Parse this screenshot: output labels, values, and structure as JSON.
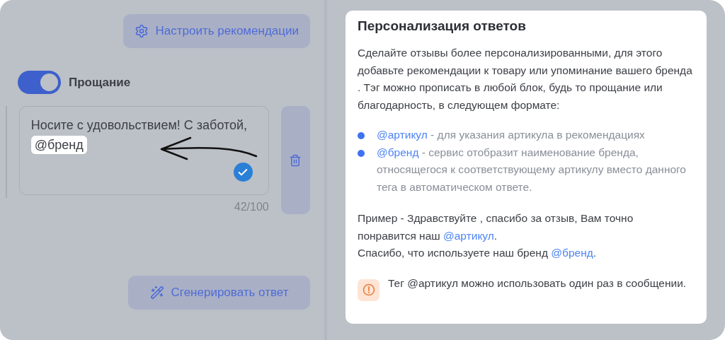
{
  "left_panel": {
    "settings_button": "Настроить рекомендации",
    "farewell": {
      "label": "Прощание",
      "on": true
    },
    "message": {
      "segments": [
        {
          "kind": "text",
          "text": "Носите с удовольствием! С заботой, "
        },
        {
          "kind": "tag",
          "text": "@бренд"
        }
      ],
      "confirmed": true,
      "counter": "42/100"
    },
    "generate_button": "Сгенерировать ответ"
  },
  "card": {
    "title": "Персонализация ответов",
    "intro": "Сделайте отзывы более персонализированными, для этого добавьте рекомендации к товару или упоминание вашего бренда . Тэг можно прописать в любой блок, будь то прощание или благодарность, в следующем формате:",
    "tags": [
      {
        "tag": "@артикул",
        "description": " - для указания артикула в рекомендациях"
      },
      {
        "tag": "@бренд",
        "description": " - сервис отобразит наименование бренда, относящегося к соответствующему артикулу вместо данного тега в автоматическом ответе."
      }
    ],
    "example_lines": [
      [
        {
          "kind": "text",
          "text": "Пример - Здравствуйте , спасибо за отзыв, Вам точно понравится наш "
        },
        {
          "kind": "tag",
          "text": "@артикул"
        },
        {
          "kind": "text",
          "text": "."
        }
      ],
      [
        {
          "kind": "text",
          "text": "Спасибо, что используете наш бренд "
        },
        {
          "kind": "tag",
          "text": "@бренд"
        },
        {
          "kind": "text",
          "text": "."
        }
      ]
    ],
    "warning": "Тег @артикул можно использовать один раз в сообщении."
  }
}
